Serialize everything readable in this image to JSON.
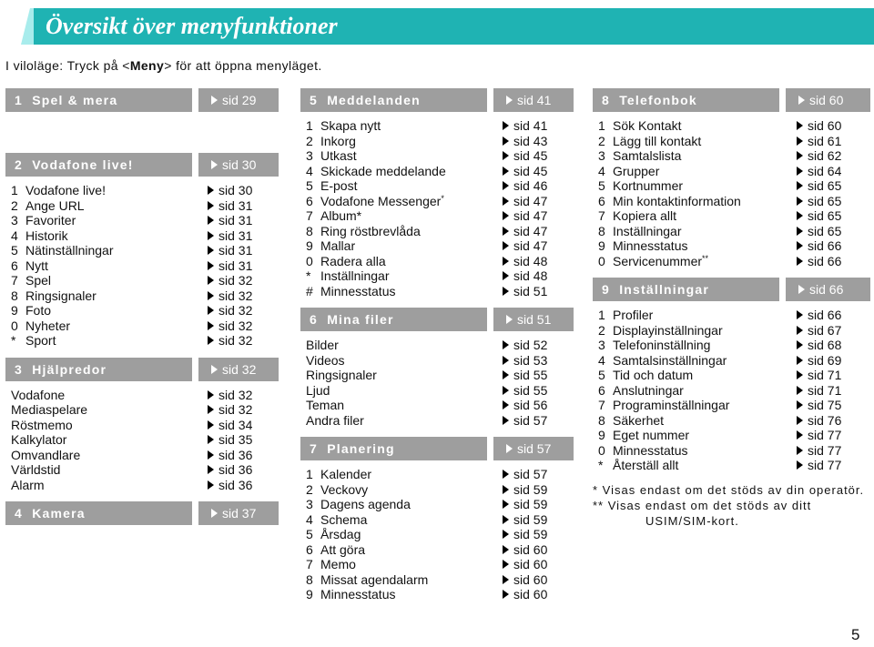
{
  "banner": {
    "title": "Översikt över menyfunktioner",
    "color": "#1fb3b3",
    "accent": "#a8ecec"
  },
  "intro": {
    "prefix": "I viloläge: Tryck på <",
    "key": "Meny",
    "suffix": "> för att öppna menyläget."
  },
  "header_color": "#9e9e9e",
  "sections": [
    {
      "id": "spel",
      "num": "1",
      "name": "Spel & mera",
      "page": "sid 29",
      "items": []
    },
    {
      "id": "vodafone-live",
      "num": "2",
      "name": "Vodafone live!",
      "page": "sid 30",
      "items": [
        {
          "num": "1",
          "label": "Vodafone live!",
          "page": "sid 30"
        },
        {
          "num": "2",
          "label": "Ange URL",
          "page": "sid 31"
        },
        {
          "num": "3",
          "label": "Favoriter",
          "page": "sid 31"
        },
        {
          "num": "4",
          "label": "Historik",
          "page": "sid 31"
        },
        {
          "num": "5",
          "label": "Nätinställningar",
          "page": "sid 31"
        },
        {
          "num": "6",
          "label": "Nytt",
          "page": "sid 31"
        },
        {
          "num": "7",
          "label": "Spel",
          "page": "sid 32"
        },
        {
          "num": "8",
          "label": "Ringsignaler",
          "page": "sid 32"
        },
        {
          "num": "9",
          "label": "Foto",
          "page": "sid 32"
        },
        {
          "num": "0",
          "label": "Nyheter",
          "page": "sid 32"
        },
        {
          "num": "*",
          "label": "Sport",
          "page": "sid 32"
        }
      ]
    },
    {
      "id": "hjalpredor",
      "num": "3",
      "name": "Hjälpredor",
      "page": "sid 32",
      "items": [
        {
          "num": "",
          "label": "Vodafone",
          "page": "sid 32"
        },
        {
          "num": "",
          "label": "Mediaspelare",
          "page": "sid 32"
        },
        {
          "num": "",
          "label": "Röstmemo",
          "page": "sid 34"
        },
        {
          "num": "",
          "label": "Kalkylator",
          "page": "sid 35"
        },
        {
          "num": "",
          "label": "Omvandlare",
          "page": "sid 36"
        },
        {
          "num": "",
          "label": "Världstid",
          "page": "sid 36"
        },
        {
          "num": "",
          "label": "Alarm",
          "page": "sid 36"
        }
      ]
    },
    {
      "id": "kamera",
      "num": "4",
      "name": "Kamera",
      "page": "sid 37",
      "items": []
    },
    {
      "id": "meddelanden",
      "num": "5",
      "name": "Meddelanden",
      "page": "sid 41",
      "items": [
        {
          "num": "1",
          "label": "Skapa nytt",
          "page": "sid 41"
        },
        {
          "num": "2",
          "label": "Inkorg",
          "page": "sid 43"
        },
        {
          "num": "3",
          "label": "Utkast",
          "page": "sid 45"
        },
        {
          "num": "4",
          "label": "Skickade meddelande",
          "page": "sid 45"
        },
        {
          "num": "5",
          "label": "E-post",
          "page": "sid 46"
        },
        {
          "num": "6",
          "label": "Vodafone Messenger",
          "mark": "*",
          "page": "sid 47"
        },
        {
          "num": "7",
          "label": "Album*",
          "page": "sid 47"
        },
        {
          "num": "8",
          "label": "Ring röstbrevlåda",
          "page": "sid 47"
        },
        {
          "num": "9",
          "label": "Mallar",
          "page": "sid 47"
        },
        {
          "num": "0",
          "label": "Radera alla",
          "page": "sid 48"
        },
        {
          "num": "*",
          "label": "Inställningar",
          "page": "sid 48"
        },
        {
          "num": "#",
          "label": "Minnesstatus",
          "page": "sid 51"
        }
      ]
    },
    {
      "id": "mina-filer",
      "num": "6",
      "name": "Mina filer",
      "page": "sid 51",
      "items": [
        {
          "num": "",
          "label": "Bilder",
          "page": "sid 52"
        },
        {
          "num": "",
          "label": "Videos",
          "page": "sid 53"
        },
        {
          "num": "",
          "label": "Ringsignaler",
          "page": "sid 55"
        },
        {
          "num": "",
          "label": "Ljud",
          "page": "sid 55"
        },
        {
          "num": "",
          "label": "Teman",
          "page": "sid 56"
        },
        {
          "num": "",
          "label": "Andra filer",
          "page": "sid 57"
        }
      ]
    },
    {
      "id": "planering",
      "num": "7",
      "name": "Planering",
      "page": "sid 57",
      "items": [
        {
          "num": "1",
          "label": "Kalender",
          "page": "sid 57"
        },
        {
          "num": "2",
          "label": "Veckovy",
          "page": "sid 59"
        },
        {
          "num": "3",
          "label": "Dagens agenda",
          "page": "sid 59"
        },
        {
          "num": "4",
          "label": "Schema",
          "page": "sid 59"
        },
        {
          "num": "5",
          "label": "Årsdag",
          "page": "sid 59"
        },
        {
          "num": "6",
          "label": "Att göra",
          "page": "sid 60"
        },
        {
          "num": "7",
          "label": "Memo",
          "page": "sid 60"
        },
        {
          "num": "8",
          "label": "Missat agendalarm",
          "page": "sid 60"
        },
        {
          "num": "9",
          "label": "Minnesstatus",
          "page": "sid 60"
        }
      ]
    },
    {
      "id": "telefonbok",
      "num": "8",
      "name": "Telefonbok",
      "page": "sid 60",
      "items": [
        {
          "num": "1",
          "label": "Sök Kontakt",
          "page": "sid 60"
        },
        {
          "num": "2",
          "label": "Lägg till kontakt",
          "page": "sid 61"
        },
        {
          "num": "3",
          "label": "Samtalslista",
          "page": "sid 62"
        },
        {
          "num": "4",
          "label": "Grupper",
          "page": "sid 64"
        },
        {
          "num": "5",
          "label": "Kortnummer",
          "page": "sid 65"
        },
        {
          "num": "6",
          "label": "Min kontaktinformation",
          "page": "sid 65"
        },
        {
          "num": "7",
          "label": "Kopiera allt",
          "page": "sid 65"
        },
        {
          "num": "8",
          "label": "Inställningar",
          "page": "sid 65"
        },
        {
          "num": "9",
          "label": "Minnesstatus",
          "page": "sid 66"
        },
        {
          "num": "0",
          "label": "Servicenummer",
          "mark": "**",
          "page": "sid 66"
        }
      ]
    },
    {
      "id": "installningar",
      "num": "9",
      "name": "Inställningar",
      "page": "sid 66",
      "items": [
        {
          "num": "1",
          "label": "Profiler",
          "page": "sid 66"
        },
        {
          "num": "2",
          "label": "Displayinställningar",
          "page": "sid 67"
        },
        {
          "num": "3",
          "label": "Telefoninställning",
          "page": "sid 68"
        },
        {
          "num": "4",
          "label": "Samtalsinställningar",
          "page": "sid 69"
        },
        {
          "num": "5",
          "label": "Tid och datum",
          "page": "sid 71"
        },
        {
          "num": "6",
          "label": "Anslutningar",
          "page": "sid 71"
        },
        {
          "num": "7",
          "label": "Programinställningar",
          "page": "sid 75"
        },
        {
          "num": "8",
          "label": "Säkerhet",
          "page": "sid 76"
        },
        {
          "num": "9",
          "label": "Eget nummer",
          "page": "sid 77"
        },
        {
          "num": "0",
          "label": "Minnesstatus",
          "page": "sid 77"
        },
        {
          "num": "*",
          "label": "Återställ allt",
          "page": "sid 77"
        }
      ]
    }
  ],
  "footnotes": [
    "* Visas endast om det stöds av din operatör.",
    "** Visas endast om det stöds av ditt",
    "USIM/SIM-kort."
  ],
  "page_number": "5"
}
